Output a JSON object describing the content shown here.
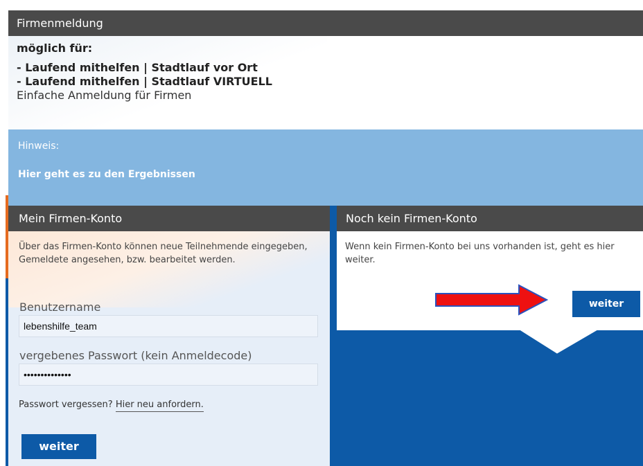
{
  "firmenmeldung": {
    "title": "Firmenmeldung",
    "possible_label": "möglich für:",
    "events": [
      "- Laufend mithelfen | Stadtlauf vor Ort",
      "- Laufend mithelfen | Stadtlauf VIRTUELL"
    ],
    "description": "Einfache Anmeldung für Firmen"
  },
  "hinweis": {
    "label": "Hinweis:",
    "link": "Hier geht es zu den Ergebnissen"
  },
  "login": {
    "title": "Mein Firmen-Konto",
    "description": "Über das Firmen-Konto können neue Teilnehmende eingegeben, Gemeldete angesehen, bzw. bearbeitet werden.",
    "username_label": "Benutzername",
    "username_value": "lebenshilfe_team",
    "password_label": "vergebenes Passwort (kein Anmeldecode)",
    "password_value": "••••••••••••••",
    "forgot_text": "Passwort vergessen?",
    "forgot_link": "Hier neu anfordern.",
    "submit_label": "weiter"
  },
  "register": {
    "title": "Noch kein Firmen-Konto",
    "description": "Wenn kein Firmen-Konto bei uns vorhanden ist, geht es hier weiter.",
    "submit_label": "weiter"
  },
  "colors": {
    "header_bg": "#4a4a4a",
    "hinweis_bg": "#84b6e0",
    "button_bg": "#0d5aa7",
    "arrow_fill": "#ee1111"
  },
  "icons": [
    "arrow-right-annotation-icon"
  ]
}
